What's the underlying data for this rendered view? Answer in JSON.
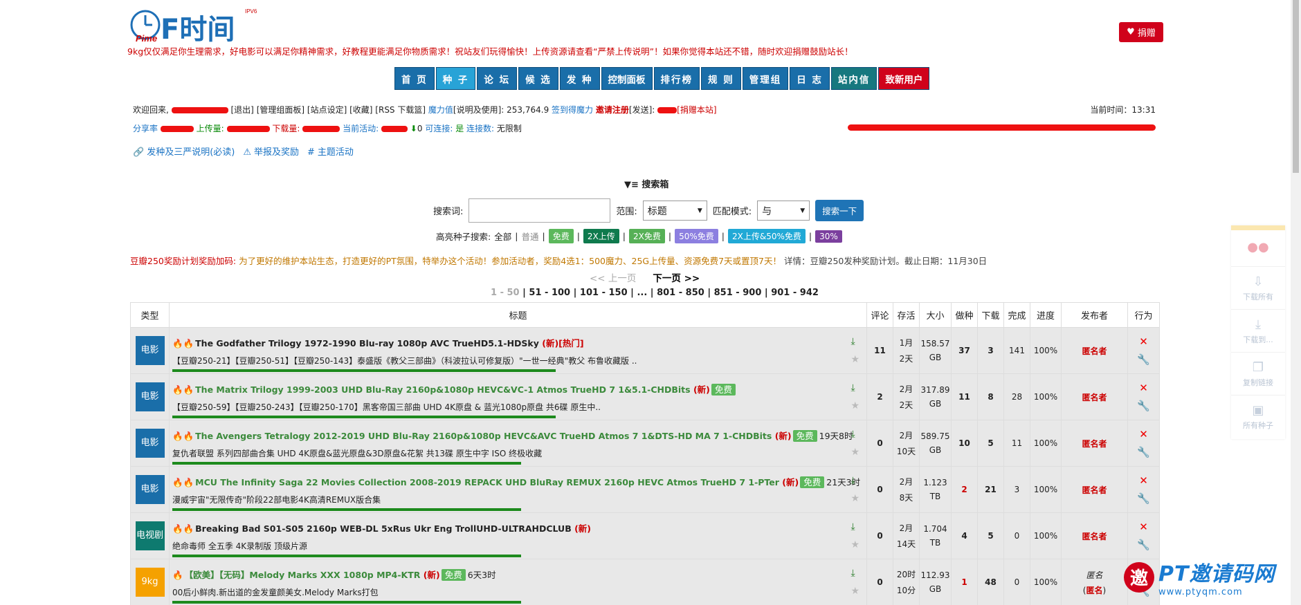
{
  "logo": {
    "text": "PT时间",
    "sup": "IPV6",
    "brand_color": "#1e6fb6"
  },
  "slogan": "9kg仅仅满足你生理需求，好电影可以满足你精神需求，好教程更能满足你物质需求！祝站友们玩得愉快！上传资源请查看“严禁上传说明”！如果你觉得本站还不错，随时欢迎捐赠鼓励站长！",
  "donate": "捐赠",
  "nav": [
    "首 页",
    "种 子",
    "论 坛",
    "候 选",
    "发 种",
    "控制面板",
    "排行榜",
    "规 则",
    "管理组",
    "日 志",
    "站内信",
    "致新用户"
  ],
  "info": {
    "welcome": "欢迎回来,",
    "logout": "[退出]",
    "manage": "[管理组面板]",
    "settings": "[站点设定]",
    "fav": "[收藏]",
    "rss": "[RSS 下载篮]",
    "magic": "魔力值",
    "magic_detail": "[说明及使用]: 253,764.9",
    "signin": "签到得魔力",
    "invite": "邀请注册",
    "sent": "[发送]:",
    "donate_link": "[捐赠本站]",
    "time_label": "当前时间：",
    "time": "13:31",
    "ratio": "分享率",
    "upload": "上传量:",
    "download": "下载量:",
    "active": "当前活动:",
    "active_down": "0",
    "connectable_label": "可连接:",
    "connectable": "是",
    "conn_count_label": "连接数:",
    "conn_count": "无限制"
  },
  "links": [
    "发种及三严说明(必读)",
    "举报及奖励",
    "主题活动"
  ],
  "search": {
    "heading": "搜索箱",
    "keyword_label": "搜索词:",
    "scope_label": "范围:",
    "scope": "标题",
    "mode_label": "匹配模式:",
    "mode": "与",
    "button": "搜索一下",
    "hl_label": "高亮种子搜索:",
    "hl_all": "全部",
    "hl_normal": "普通",
    "tags": [
      {
        "t": "免费",
        "c": "#5cb85c"
      },
      {
        "t": "2X上传",
        "c": "#0e7a4d"
      },
      {
        "t": "2X免费",
        "c": "#56b056"
      },
      {
        "t": "50%免费",
        "c": "#8c7fe0"
      },
      {
        "t": "2X上传&50%免费",
        "c": "#21a9d6"
      },
      {
        "t": "30%",
        "c": "#7b3f9e"
      }
    ]
  },
  "promo": {
    "a": "豆瓣250奖励计划奖励加码:",
    "b": "为了更好的维护本站生态，打造更好的PT氛围，特举办这个活动！参加活动者，奖励4选1：500魔力、25G上传量、资源免费7天或置顶7天！",
    "c": "详情：豆瓣250发种奖励计划。截止日期：11月30日"
  },
  "pager": {
    "prev": "<< 上一页",
    "next": "下一页 >>",
    "current": "1 - 50",
    "pages": [
      "51 - 100",
      "101 - 150",
      "...",
      "801 - 850",
      "851 - 900",
      "901 - 942"
    ]
  },
  "table": {
    "headers": [
      "类型",
      "标题",
      "评论",
      "存活",
      "大小",
      "做种",
      "下载",
      "完成",
      "进度",
      "发布者",
      "行为"
    ],
    "rows": [
      {
        "cat": "电影",
        "cat_cls": "movie",
        "fires": "🔥🔥",
        "name": "The Godfather Trilogy 1972-1990 Blu-ray 1080p AVC TrueHD5.1-HDSky",
        "g": false,
        "new": "(新)",
        "hot": "[热门]",
        "free": "",
        "time": "",
        "desc": "【豆瓣250-21】【豆瓣250-51】【豆瓣250-143】泰盛版《教父三部曲》（科波拉认可修复版）\"一世一经典\"教父 布鲁收藏版 ..",
        "comments": "11",
        "alive1": "1月",
        "alive2": "2天",
        "size1": "158.57",
        "size2": "GB",
        "seed": "37",
        "seed_red": false,
        "dl": "3",
        "done": "141",
        "prog": "100%",
        "pub": "匿名者",
        "pbar": 0.55
      },
      {
        "cat": "电影",
        "cat_cls": "movie",
        "fires": "🔥🔥",
        "name": "The Matrix Trilogy 1999-2003 UHD Blu-Ray 2160p&1080p HEVC&VC-1 Atmos TrueHD 7 1&5.1-CHDBits",
        "g": true,
        "new": "(新)",
        "hot": "",
        "free": "免费",
        "time": "",
        "desc": "【豆瓣250-59】【豆瓣250-243】【豆瓣250-170】黑客帝国三部曲 UHD 4K原盘 & 蓝光1080p原盘 共6碟 原生中..",
        "comments": "2",
        "alive1": "2月",
        "alive2": "2天",
        "size1": "317.89",
        "size2": "GB",
        "seed": "11",
        "seed_red": false,
        "dl": "8",
        "done": "28",
        "prog": "100%",
        "pub": "匿名者",
        "pbar": 0.55
      },
      {
        "cat": "电影",
        "cat_cls": "movie",
        "fires": "🔥🔥",
        "name": "The Avengers Tetralogy 2012-2019 UHD Blu-Ray 2160p&1080p HEVC&AVC TrueHD Atmos 7 1&DTS-HD MA 7 1-CHDBits",
        "g": true,
        "new": "(新)",
        "hot": "",
        "free": "免费",
        "time": "19天8时",
        "desc": "复仇者联盟 系列四部曲合集 UHD 4K原盘&蓝光原盘&3D原盘&花絮 共13碟 原生中字 ISO 终极收藏",
        "comments": "0",
        "alive1": "2月",
        "alive2": "10天",
        "size1": "589.75",
        "size2": "GB",
        "seed": "10",
        "seed_red": false,
        "dl": "5",
        "done": "11",
        "prog": "100%",
        "pub": "匿名者",
        "pbar": 0.5
      },
      {
        "cat": "电影",
        "cat_cls": "movie",
        "fires": "🔥🔥",
        "name": "MCU The Infinity Saga 22 Movies Collection 2008-2019 REPACK UHD BluRay REMUX 2160p HEVC Atmos TrueHD 7 1-PTer",
        "g": true,
        "new": "(新)",
        "hot": "",
        "free": "免费",
        "time": "21天3时",
        "desc": "漫威宇宙\"无限传奇\"阶段22部电影4K高清REMUX版合集",
        "comments": "0",
        "alive1": "2月",
        "alive2": "8天",
        "size1": "1.123",
        "size2": "TB",
        "seed": "2",
        "seed_red": true,
        "dl": "21",
        "done": "3",
        "prog": "100%",
        "pub": "匿名者",
        "pbar": 0.5
      },
      {
        "cat": "电视剧",
        "cat_cls": "tv",
        "fires": "🔥🔥",
        "name": "Breaking Bad S01-S05 2160p WEB-DL 5xRus Ukr Eng TrollUHD-ULTRAHDCLUB",
        "g": false,
        "new": "(新)",
        "hot": "",
        "free": "",
        "time": "",
        "desc": "绝命毒师 全五季 4K录制版 顶级片源",
        "comments": "0",
        "alive1": "2月",
        "alive2": "14天",
        "size1": "1.704",
        "size2": "TB",
        "seed": "4",
        "seed_red": false,
        "dl": "5",
        "done": "0",
        "prog": "100%",
        "pub": "匿名者",
        "pbar": 0.5
      },
      {
        "cat": "9kg",
        "cat_cls": "kg",
        "fires": "🔥",
        "name": "【欧美】【无码】Melody Marks XXX 1080p MP4-KTR",
        "g": true,
        "new": "(新)",
        "hot": "",
        "free": "免费",
        "time": "6天3时",
        "desc": "00后小鲜肉.新出道的金发童颜美女.Melody Marks打包",
        "comments": "0",
        "alive1": "20时",
        "alive2": "10分",
        "size1": "112.93",
        "size2": "GB",
        "seed": "1",
        "seed_red": true,
        "dl": "48",
        "done": "0",
        "prog": "100%",
        "pub": "匿名",
        "pub2": "(匿名者)",
        "pbar": 0.5
      }
    ]
  },
  "sidebar": [
    "下载所有",
    "下载到...",
    "复制链接",
    "所有种子"
  ],
  "watermark": {
    "seal": "邀",
    "big": "PT邀请码网",
    "small": "www.ptyqm.com"
  }
}
